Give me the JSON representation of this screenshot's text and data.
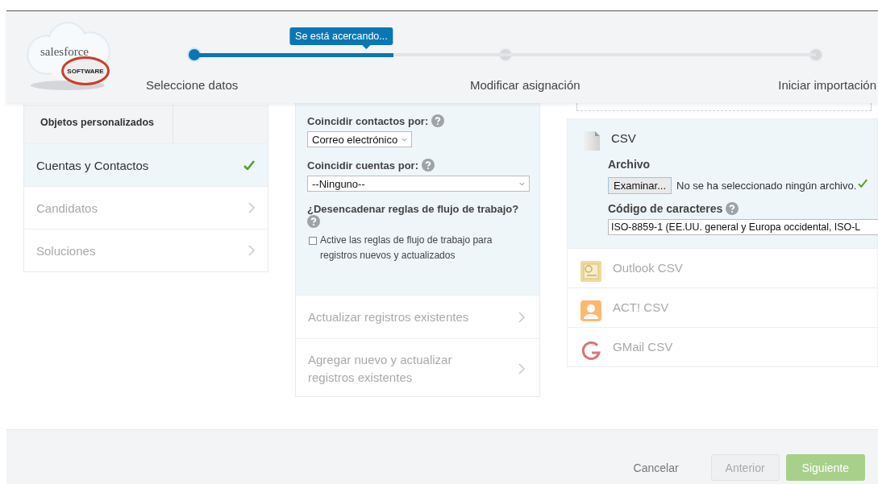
{
  "logo": {
    "wordmark": "salesforce",
    "badge": "SOFTWARE"
  },
  "progress": {
    "tooltip": "Se está acercando...",
    "level": 0.32,
    "steps": [
      {
        "label": "Seleccione datos",
        "reached": true
      },
      {
        "label": "Modificar asignación",
        "reached": false
      },
      {
        "label": "Iniciar importación",
        "reached": false
      }
    ]
  },
  "objects": {
    "header": "Objetos personalizados",
    "items": [
      {
        "label": "Cuentas y Contactos",
        "selected": true,
        "done": true
      },
      {
        "label": "Candidatos",
        "selected": false,
        "done": false
      },
      {
        "label": "Soluciones",
        "selected": false,
        "done": false
      }
    ]
  },
  "options": {
    "fields": [
      {
        "label": "Coincidir contactos por:",
        "value": "Correo electrónico"
      },
      {
        "label": "Coincidir cuentas por:",
        "value": "--Ninguno--"
      }
    ],
    "workflow": {
      "question": "¿Desencadenar reglas de flujo de trabajo?",
      "checkbox_label": "Active las reglas de flujo de trabajo para registros nuevos y actualizados",
      "checked": false
    },
    "actions": [
      {
        "label": "Actualizar registros existentes"
      },
      {
        "label": "Agregar nuevo y actualizar registros existentes"
      }
    ]
  },
  "sources": [
    {
      "label": "CSV",
      "kind": "csv",
      "selected": true,
      "file_label": "Archivo",
      "browse_button": "Examinar...",
      "file_status": "No se ha seleccionado ningún archivo.",
      "encoding_label": "Código de caracteres",
      "encoding_value": "ISO-8859-1 (EE.UU. general y Europa occidental, ISO-L"
    },
    {
      "label": "Outlook CSV",
      "kind": "outlook",
      "selected": false
    },
    {
      "label": "ACT! CSV",
      "kind": "act",
      "selected": false
    },
    {
      "label": "GMail CSV",
      "kind": "gmail",
      "selected": false
    }
  ],
  "footer": [
    {
      "label": "Cancelar",
      "kind": "link",
      "disabled": false
    },
    {
      "label": "Anterior",
      "kind": "secondary",
      "disabled": true
    },
    {
      "label": "Siguiente",
      "kind": "primary",
      "disabled": true
    }
  ]
}
